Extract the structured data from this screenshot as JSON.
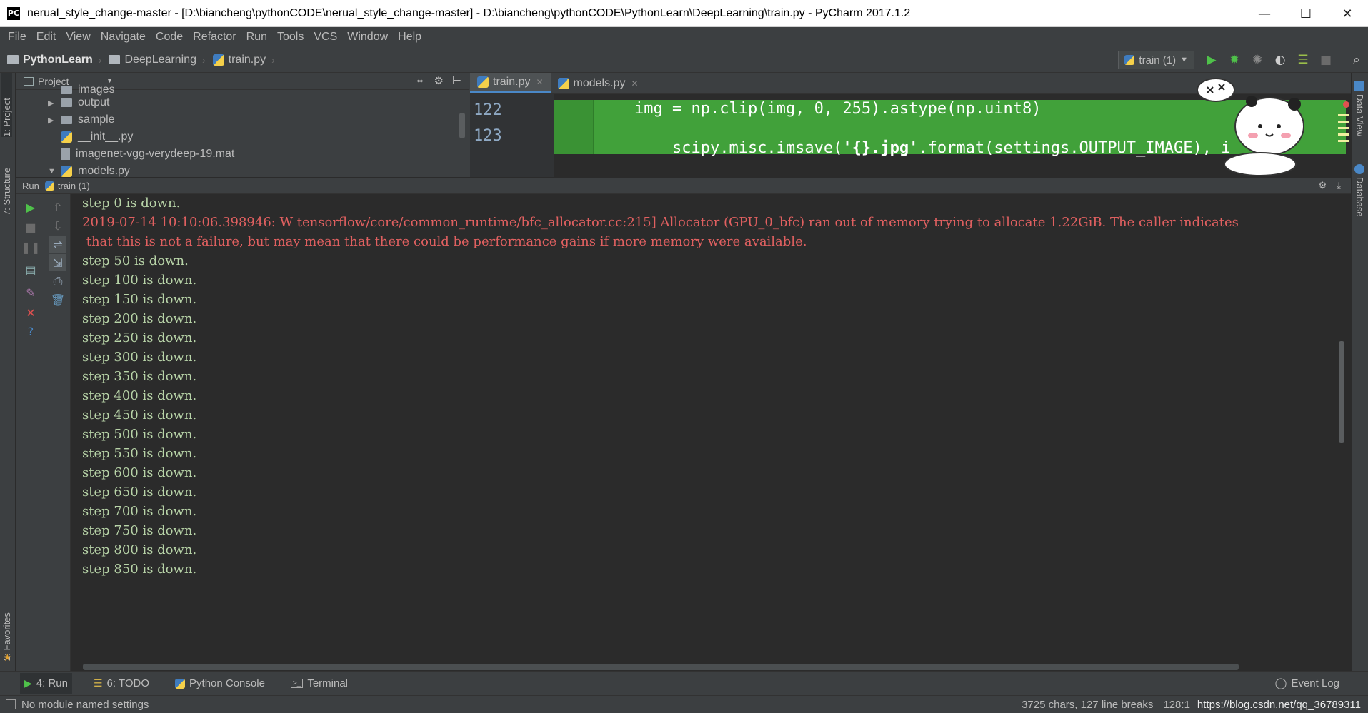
{
  "window": {
    "title": "nerual_style_change-master - [D:\\biancheng\\pythonCODE\\nerual_style_change-master] - D:\\biancheng\\pythonCODE\\PythonLearn\\DeepLearning\\train.py - PyCharm 2017.1.2",
    "controls": [
      "—",
      "☐",
      "✕"
    ]
  },
  "menu": [
    "File",
    "Edit",
    "View",
    "Navigate",
    "Code",
    "Refactor",
    "Run",
    "Tools",
    "VCS",
    "Window",
    "Help"
  ],
  "breadcrumb": [
    "PythonLearn",
    "DeepLearning",
    "train.py"
  ],
  "run_config": "train (1)",
  "left_stripe": {
    "project": "1: Project",
    "structure": "7: Structure",
    "favorites": "2: Favorites"
  },
  "right_stripe": {
    "data_view": "Data View",
    "database": "Database"
  },
  "project_panel": {
    "label": "Project",
    "tree": [
      {
        "name": "images",
        "type": "folder",
        "arrow": ""
      },
      {
        "name": "output",
        "type": "folder",
        "arrow": "▶"
      },
      {
        "name": "sample",
        "type": "folder",
        "arrow": "▶"
      },
      {
        "name": "__init__.py",
        "type": "py",
        "arrow": ""
      },
      {
        "name": "imagenet-vgg-verydeep-19.mat",
        "type": "file",
        "arrow": ""
      },
      {
        "name": "models.py",
        "type": "py",
        "arrow": "▼"
      }
    ]
  },
  "editor": {
    "tabs": [
      {
        "label": "train.py",
        "active": true
      },
      {
        "label": "models.py",
        "active": false
      }
    ],
    "lines": [
      {
        "num": "122",
        "code": "img = np.clip(img, 0, 255).astype(np.uint8)"
      },
      {
        "num": "123",
        "pre": "scipy.misc.imsave(",
        "bold": "'{}.jpg'",
        "post": ".format(settings.OUTPUT_IMAGE), i"
      }
    ],
    "highlight_color": "#41a13a"
  },
  "run": {
    "header_label": "Run",
    "config": "train (1)",
    "console": [
      {
        "text": "step 0 is down.",
        "kind": "out"
      },
      {
        "text": "2019-07-14 10:10:06.398946: W tensorflow/core/common_runtime/bfc_allocator.cc:215] Allocator (GPU_0_bfc) ran out of memory trying to allocate 1.22GiB. The caller indicates",
        "kind": "err"
      },
      {
        "text": " that this is not a failure, but may mean that there could be performance gains if more memory were available.",
        "kind": "err"
      },
      {
        "text": "step 50 is down.",
        "kind": "out"
      },
      {
        "text": "step 100 is down.",
        "kind": "out"
      },
      {
        "text": "step 150 is down.",
        "kind": "out"
      },
      {
        "text": "step 200 is down.",
        "kind": "out"
      },
      {
        "text": "step 250 is down.",
        "kind": "out"
      },
      {
        "text": "step 300 is down.",
        "kind": "out"
      },
      {
        "text": "step 350 is down.",
        "kind": "out"
      },
      {
        "text": "step 400 is down.",
        "kind": "out"
      },
      {
        "text": "step 450 is down.",
        "kind": "out"
      },
      {
        "text": "step 500 is down.",
        "kind": "out"
      },
      {
        "text": "step 550 is down.",
        "kind": "out"
      },
      {
        "text": "step 600 is down.",
        "kind": "out"
      },
      {
        "text": "step 650 is down.",
        "kind": "out"
      },
      {
        "text": "step 700 is down.",
        "kind": "out"
      },
      {
        "text": "step 750 is down.",
        "kind": "out"
      },
      {
        "text": "step 800 is down.",
        "kind": "out"
      },
      {
        "text": "step 850 is down.",
        "kind": "out"
      }
    ]
  },
  "bottom_tabs": [
    {
      "label": "4: Run",
      "icon": "run-icon",
      "active": true
    },
    {
      "label": "6: TODO",
      "icon": "todo-icon",
      "active": false
    },
    {
      "label": "Python Console",
      "icon": "python-console-icon",
      "active": false
    },
    {
      "label": "Terminal",
      "icon": "terminal-icon",
      "active": false
    }
  ],
  "event_log": "Event Log",
  "status": {
    "message": "No module named settings",
    "chars": "3725 chars, 127 line breaks",
    "position": "128:1",
    "watermark": "https://blog.csdn.net/qq_36789311"
  },
  "colors": {
    "error": "#e06060",
    "output": "#b8d4a8",
    "accent": "#4a88c7"
  }
}
